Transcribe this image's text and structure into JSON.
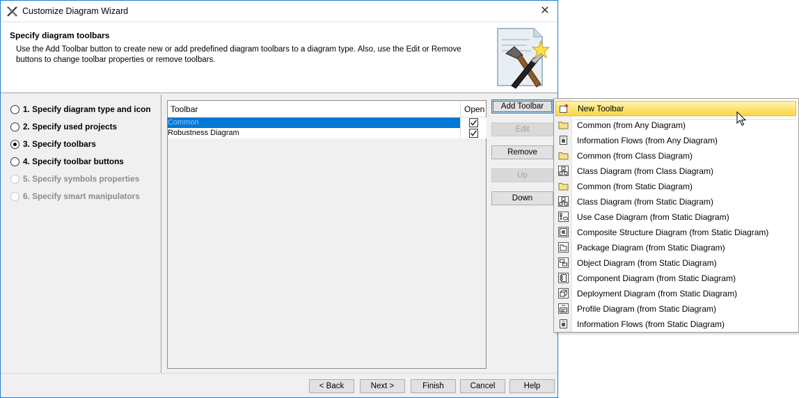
{
  "window": {
    "title": "Customize Diagram Wizard",
    "close_glyph": "✕"
  },
  "header": {
    "title": "Specify diagram toolbars",
    "description": "Use the Add Toolbar button to create new or add predefined diagram toolbars to a diagram type. Also, use the Edit or Remove buttons to change toolbar properties or remove toolbars."
  },
  "steps": [
    {
      "label": "1. Specify diagram type and icon",
      "selected": false,
      "enabled": true
    },
    {
      "label": "2. Specify used projects",
      "selected": false,
      "enabled": true
    },
    {
      "label": "3. Specify toolbars",
      "selected": true,
      "enabled": true
    },
    {
      "label": "4. Specify toolbar buttons",
      "selected": false,
      "enabled": true
    },
    {
      "label": "5. Specify symbols properties",
      "selected": false,
      "enabled": false
    },
    {
      "label": "6. Specify smart manipulators",
      "selected": false,
      "enabled": false
    }
  ],
  "table": {
    "columns": [
      "Toolbar",
      "Open"
    ],
    "rows": [
      {
        "name": "Common",
        "open": true,
        "selected": true
      },
      {
        "name": "Robustness Diagram",
        "open": true,
        "selected": false
      }
    ]
  },
  "side_buttons": {
    "add_toolbar": "Add Toolbar",
    "edit": "Edit",
    "remove": "Remove",
    "up": "Up",
    "down": "Down"
  },
  "footer_buttons": {
    "back": "< Back",
    "next": "Next >",
    "finish": "Finish",
    "cancel": "Cancel",
    "help": "Help"
  },
  "menu": {
    "items": [
      {
        "label": "New Toolbar",
        "icon": "new-toolbar-icon"
      },
      {
        "label": "Common (from Any Diagram)",
        "icon": "folder-icon"
      },
      {
        "label": "Information Flows (from Any Diagram)",
        "icon": "information-flow-icon"
      },
      {
        "label": "Common (from Class Diagram)",
        "icon": "folder-icon"
      },
      {
        "label": "Class Diagram (from Class Diagram)",
        "icon": "class-diagram-icon"
      },
      {
        "label": "Common (from Static Diagram)",
        "icon": "folder-icon"
      },
      {
        "label": "Class Diagram (from Static Diagram)",
        "icon": "class-diagram-icon"
      },
      {
        "label": "Use Case Diagram (from Static Diagram)",
        "icon": "use-case-diagram-icon"
      },
      {
        "label": "Composite Structure Diagram (from Static Diagram)",
        "icon": "composite-structure-icon"
      },
      {
        "label": "Package Diagram (from Static Diagram)",
        "icon": "package-diagram-icon"
      },
      {
        "label": "Object Diagram (from Static Diagram)",
        "icon": "object-diagram-icon"
      },
      {
        "label": "Component Diagram (from Static Diagram)",
        "icon": "component-diagram-icon"
      },
      {
        "label": "Deployment Diagram (from Static Diagram)",
        "icon": "deployment-diagram-icon"
      },
      {
        "label": "Profile Diagram (from Static Diagram)",
        "icon": "profile-diagram-icon"
      },
      {
        "label": "Information Flows (from Static Diagram)",
        "icon": "information-flow-icon"
      }
    ]
  },
  "colors": {
    "selection": "#0078d7",
    "menu_highlight": "#f9d648",
    "window_border": "#1c7bd6"
  }
}
